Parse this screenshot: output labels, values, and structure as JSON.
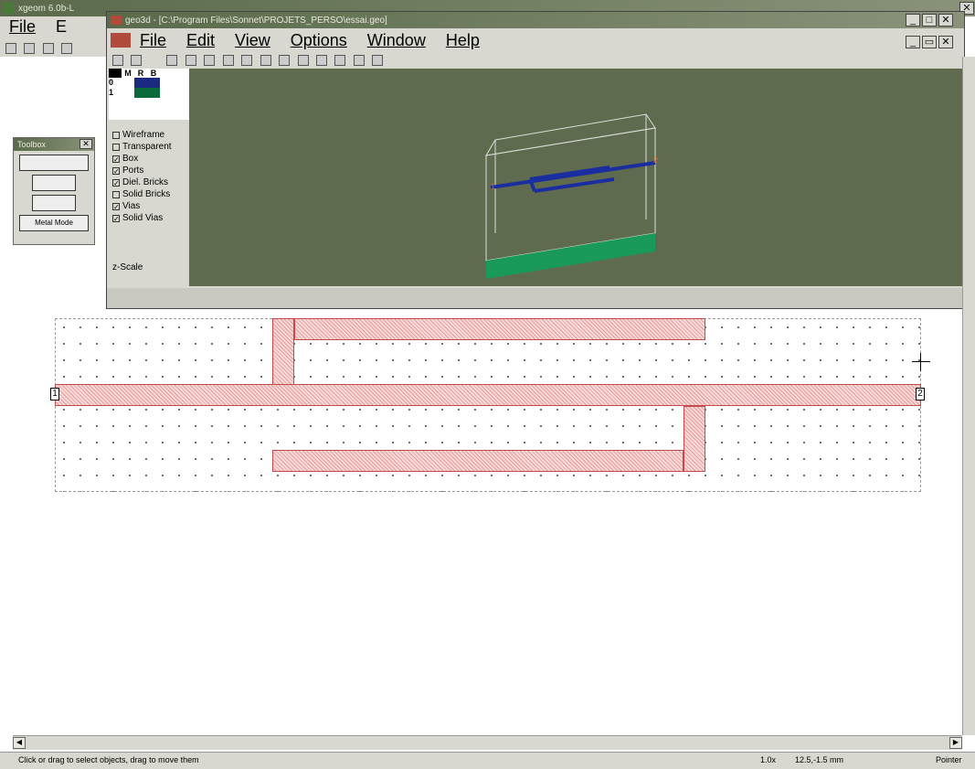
{
  "outer_window": {
    "title": "xgeom 6.0b-L",
    "menu": [
      "File",
      "E"
    ]
  },
  "geo3d": {
    "title": "geo3d - [C:\\Program Files\\Sonnet\\PROJETS_PERSO\\essai.geo]",
    "menu": [
      "File",
      "Edit",
      "View",
      "Options",
      "Window",
      "Help"
    ],
    "table_headers": [
      "M",
      "R",
      "B"
    ],
    "table_rows": [
      "0",
      "1"
    ],
    "options": [
      {
        "label": "Wireframe",
        "checked": false
      },
      {
        "label": "Transparent",
        "checked": false
      },
      {
        "label": "Box",
        "checked": true
      },
      {
        "label": "Ports",
        "checked": true
      },
      {
        "label": "Diel. Bricks",
        "checked": true
      },
      {
        "label": "Solid Bricks",
        "checked": false
      },
      {
        "label": "Vias",
        "checked": true
      },
      {
        "label": "Solid Vias",
        "checked": true
      }
    ],
    "zscale_label": "z-Scale",
    "port_labels": [
      "1",
      "2"
    ],
    "viewport_color": "#5e6b4e"
  },
  "toolbox": {
    "title": "Toolbox",
    "mode_button": "Metal Mode"
  },
  "layout": {
    "port_left": "1",
    "port_right": "2"
  },
  "status": {
    "message": "Click or drag to select objects, drag to move them",
    "zoom": "1.0x",
    "coords": "12.5,-1.5 mm",
    "mode": "Pointer"
  }
}
